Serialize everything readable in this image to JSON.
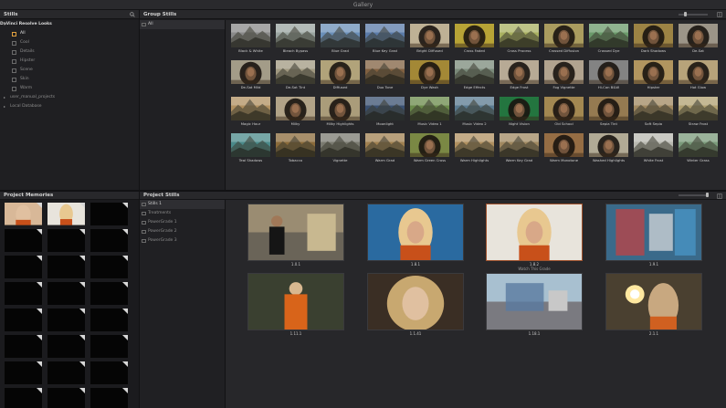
{
  "window": {
    "title": "Gallery"
  },
  "stills_panel": {
    "title": "Stills"
  },
  "group_stills_panel": {
    "title": "Group Stills"
  },
  "project_memories_panel": {
    "title": "Project Memories"
  },
  "project_stills_panel": {
    "title": "Project Stills"
  },
  "tree": [
    {
      "label": "DaVinci Resolve Looks",
      "kind": "top",
      "caret": "▾"
    },
    {
      "label": "All",
      "kind": "sub",
      "selected": true
    },
    {
      "label": "Cool",
      "kind": "sub"
    },
    {
      "label": "Details",
      "kind": "sub"
    },
    {
      "label": "Hipster",
      "kind": "sub"
    },
    {
      "label": "Scene",
      "kind": "sub"
    },
    {
      "label": "Skin",
      "kind": "sub"
    },
    {
      "label": "Warm",
      "kind": "sub"
    },
    {
      "label": "user_manual_projects",
      "kind": "folder",
      "caret": "▸"
    },
    {
      "label": "Local Database",
      "kind": "folder",
      "caret": "▸"
    }
  ],
  "group_albums": [
    {
      "label": "All",
      "selected": true
    }
  ],
  "project_albums": [
    {
      "label": "Stills 1",
      "selected": true
    },
    {
      "label": "Treatments"
    },
    {
      "label": "PowerGrade 1"
    },
    {
      "label": "PowerGrade 2"
    },
    {
      "label": "PowerGrade 3"
    }
  ],
  "looks": [
    {
      "label": "Black & White",
      "subject": "mountain",
      "tint": "#8a8a8a"
    },
    {
      "label": "Bleach Bypass",
      "subject": "mountain",
      "tint": "#9aa4a0"
    },
    {
      "label": "Blue Grad",
      "subject": "mountain",
      "tint": "#6a8fb8"
    },
    {
      "label": "Blue Key Grad",
      "subject": "mountain",
      "tint": "#5a7aa8"
    },
    {
      "label": "Bright Diffused",
      "subject": "face",
      "tint": "#e0d0b0"
    },
    {
      "label": "Cross Faded",
      "subject": "face",
      "tint": "#d8c040"
    },
    {
      "label": "Cross Process",
      "subject": "mountain",
      "tint": "#a8b060"
    },
    {
      "label": "Crossed Diffusion",
      "subject": "face",
      "tint": "#c8b870"
    },
    {
      "label": "Crossed Dye",
      "subject": "mountain",
      "tint": "#6a9a6a"
    },
    {
      "label": "Dark Shadows",
      "subject": "face",
      "tint": "#b89a50"
    },
    {
      "label": "De-Sat",
      "subject": "face",
      "tint": "#b8b0a0"
    },
    {
      "label": "De-Sat Mild",
      "subject": "face",
      "tint": "#c0b8a0"
    },
    {
      "label": "De-Sat Tint",
      "subject": "mountain",
      "tint": "#a09880"
    },
    {
      "label": "Diffused",
      "subject": "face",
      "tint": "#d0c090"
    },
    {
      "label": "Duo Tone",
      "subject": "mountain",
      "tint": "#806040"
    },
    {
      "label": "Dye Wash",
      "subject": "face",
      "tint": "#c0a040"
    },
    {
      "label": "Edge Effects",
      "subject": "mountain",
      "tint": "#7a8a7a"
    },
    {
      "label": "Edge Frost",
      "subject": "face",
      "tint": "#d8c8b0"
    },
    {
      "label": "Fog Vignette",
      "subject": "face",
      "tint": "#d0c0a8"
    },
    {
      "label": "Hi-Con B&W",
      "subject": "face",
      "tint": "#9a9a9a"
    },
    {
      "label": "Hipster",
      "subject": "face",
      "tint": "#d0b070"
    },
    {
      "label": "Hot Glow",
      "subject": "face",
      "tint": "#d8c090"
    },
    {
      "label": "Magic Hour",
      "subject": "mountain",
      "tint": "#b09060"
    },
    {
      "label": "Milky",
      "subject": "face",
      "tint": "#d0c0a0"
    },
    {
      "label": "Milky Highlights",
      "subject": "face",
      "tint": "#c8b890"
    },
    {
      "label": "Moonlight",
      "subject": "mountain",
      "tint": "#3a5070"
    },
    {
      "label": "Music Video 1",
      "subject": "mountain",
      "tint": "#6a8a4a"
    },
    {
      "label": "Music Video 2",
      "subject": "mountain",
      "tint": "#5a7a90"
    },
    {
      "label": "Night Vision",
      "subject": "face",
      "tint": "#2a8a4a"
    },
    {
      "label": "Old School",
      "subject": "face",
      "tint": "#c0a060"
    },
    {
      "label": "Sepia Tint",
      "subject": "face",
      "tint": "#b09060"
    },
    {
      "label": "Soft Sepia",
      "subject": "mountain",
      "tint": "#a08860"
    },
    {
      "label": "Straw Frost",
      "subject": "mountain",
      "tint": "#b0a070"
    },
    {
      "label": "Teal Shadows",
      "subject": "mountain",
      "tint": "#4a8a8a"
    },
    {
      "label": "Tobacco",
      "subject": "mountain",
      "tint": "#8a6a3a"
    },
    {
      "label": "Vignette",
      "subject": "mountain",
      "tint": "#7a7a70"
    },
    {
      "label": "Warm Grad",
      "subject": "mountain",
      "tint": "#a08050"
    },
    {
      "label": "Warm Green Cross",
      "subject": "face",
      "tint": "#90a050"
    },
    {
      "label": "Warm Highlights",
      "subject": "mountain",
      "tint": "#b09060"
    },
    {
      "label": "Warm Key Grad",
      "subject": "mountain",
      "tint": "#a08860"
    },
    {
      "label": "Warm Monotone",
      "subject": "face",
      "tint": "#b08050"
    },
    {
      "label": "Washed Highlights",
      "subject": "face",
      "tint": "#d0c8b0"
    },
    {
      "label": "White Frost",
      "subject": "mountain",
      "tint": "#b8b8b0"
    },
    {
      "label": "Winter Grass",
      "subject": "mountain",
      "tint": "#7a9a7a"
    }
  ],
  "stills": [
    {
      "label": "1.0.1",
      "sub": "",
      "scene": "man",
      "active": false
    },
    {
      "label": "1.8.1",
      "sub": "",
      "scene": "phone-blue",
      "active": false
    },
    {
      "label": "1.8.2",
      "sub": "Watch This Grade",
      "scene": "phone-white",
      "active": true
    },
    {
      "label": "1.9.1",
      "sub": "",
      "scene": "graffiti",
      "active": false
    },
    {
      "label": "1.11.1",
      "sub": "",
      "scene": "orange-suit",
      "active": false
    },
    {
      "label": "1.1.41",
      "sub": "",
      "scene": "portrait",
      "active": false
    },
    {
      "label": "1.18.1",
      "sub": "",
      "scene": "street",
      "active": false
    },
    {
      "label": "2.1.1",
      "sub": "",
      "scene": "sparkler",
      "active": false
    }
  ],
  "memories": [
    {
      "filled": true,
      "scene": "mem-a"
    },
    {
      "filled": true,
      "scene": "mem-b"
    },
    {
      "filled": false
    },
    {
      "filled": false
    },
    {
      "filled": false
    },
    {
      "filled": false
    },
    {
      "filled": false
    },
    {
      "filled": false
    },
    {
      "filled": false
    },
    {
      "filled": false
    },
    {
      "filled": false
    },
    {
      "filled": false
    },
    {
      "filled": false
    },
    {
      "filled": false
    },
    {
      "filled": false
    },
    {
      "filled": false
    },
    {
      "filled": false
    },
    {
      "filled": false
    },
    {
      "filled": false
    },
    {
      "filled": false
    },
    {
      "filled": false
    },
    {
      "filled": false
    },
    {
      "filled": false
    },
    {
      "filled": false
    }
  ],
  "icons": {
    "search": "search-icon",
    "columns": "columns-icon",
    "slider": "zoom-slider-icon"
  },
  "colors": {
    "accent": "#e0a040",
    "active_border": "#a0522d",
    "background": "#1c1c1f"
  }
}
